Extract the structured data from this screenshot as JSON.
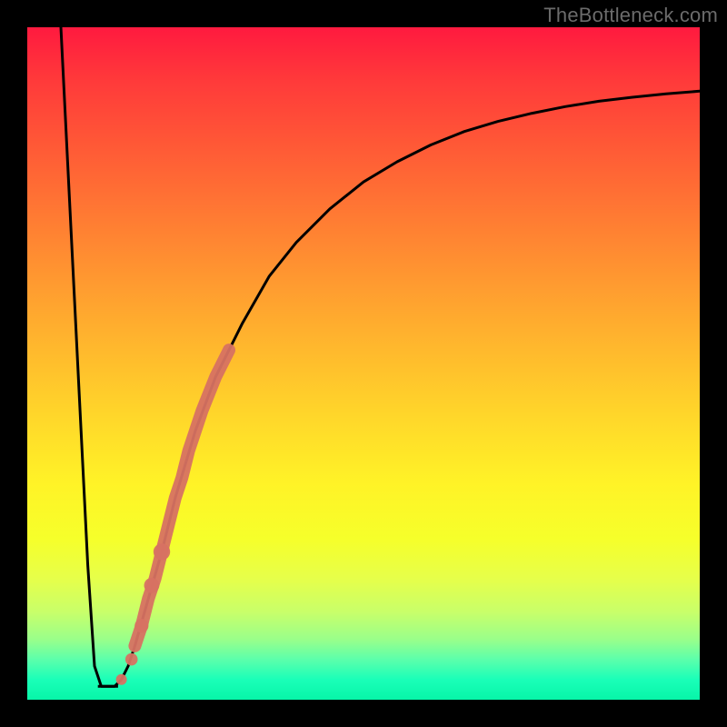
{
  "watermark": "TheBottleneck.com",
  "chart_data": {
    "type": "line",
    "title": "",
    "xlabel": "",
    "ylabel": "",
    "xlim": [
      0,
      100
    ],
    "ylim": [
      0,
      100
    ],
    "curve": {
      "x": [
        5,
        6,
        7,
        8,
        9,
        10,
        11,
        12,
        13,
        14,
        15,
        16,
        18,
        20,
        22,
        25,
        28,
        32,
        36,
        40,
        45,
        50,
        55,
        60,
        65,
        70,
        75,
        80,
        85,
        90,
        95,
        100
      ],
      "y": [
        100,
        80,
        60,
        40,
        20,
        5,
        2,
        2,
        2,
        3,
        5,
        8,
        15,
        22,
        30,
        40,
        48,
        56,
        63,
        68,
        73,
        77,
        80,
        82.5,
        84.5,
        86,
        87.2,
        88.2,
        89,
        89.6,
        90.1,
        90.5
      ]
    },
    "highlight_band": {
      "x": [
        16,
        17,
        18,
        19,
        20,
        21,
        22,
        23,
        24,
        25,
        26,
        27,
        28,
        29,
        30
      ],
      "y": [
        8,
        11,
        15,
        18,
        22,
        26,
        30,
        33,
        37,
        40,
        43,
        45.5,
        48,
        50,
        52
      ]
    },
    "highlight_dots": {
      "x": [
        14,
        15.5,
        17,
        18.5,
        20
      ],
      "y": [
        3,
        6,
        11,
        17,
        22
      ]
    },
    "flat_bottom": {
      "x0": 10.5,
      "x1": 13.5,
      "y": 2
    },
    "colors": {
      "curve": "#000000",
      "highlight": "#d77262"
    }
  }
}
